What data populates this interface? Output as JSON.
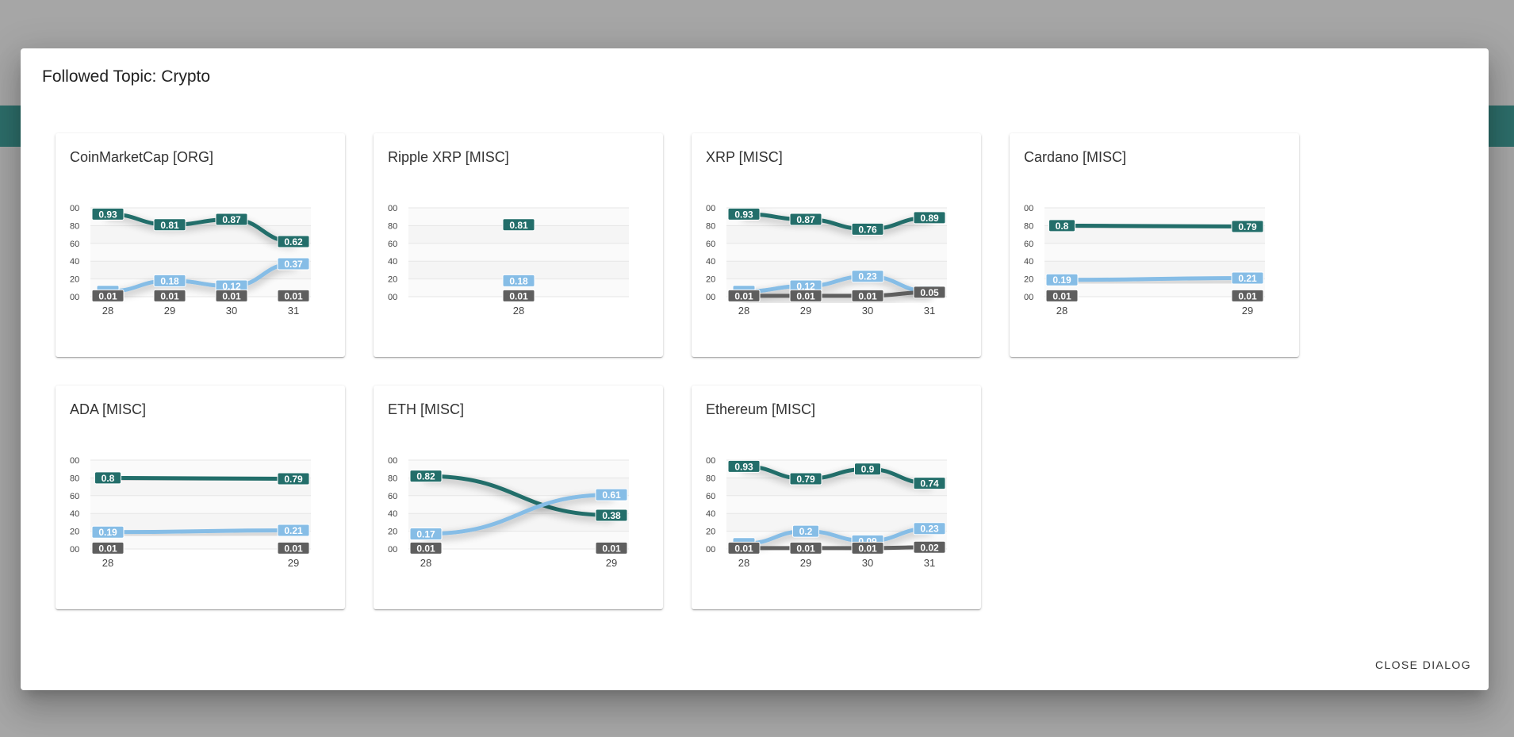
{
  "dialog": {
    "title": "Followed Topic: Crypto",
    "close_label": "CLOSE DIALOG"
  },
  "colors": {
    "positive": "#236e6a",
    "neutral": "#86bde6",
    "negative": "#5e5e5e"
  },
  "y_tick_labels": [
    "00",
    "80",
    "60",
    "40",
    "20",
    "00"
  ],
  "cards": [
    {
      "title": "CoinMarketCap [ORG]",
      "chart_data": {
        "type": "line",
        "x": [
          "28",
          "29",
          "30",
          "31"
        ],
        "ylim": [
          0,
          1
        ],
        "series": [
          {
            "values": [
              0.93,
              0.81,
              0.87,
              0.62
            ],
            "labels": [
              "0.93",
              "0.81",
              "0.87",
              "0.62"
            ]
          },
          {
            "values": [
              0.06,
              0.18,
              0.12,
              0.37
            ],
            "labels": [
              "",
              "0.18",
              "0.12",
              "0.37"
            ]
          },
          {
            "values": [
              0.01,
              0.01,
              0.01,
              0.01
            ],
            "labels": [
              "0.01",
              "0.01",
              "0.01",
              "0.01"
            ]
          }
        ]
      }
    },
    {
      "title": "Ripple XRP [MISC]",
      "chart_data": {
        "type": "line",
        "x": [
          "28"
        ],
        "ylim": [
          0,
          1
        ],
        "series": [
          {
            "values": [
              0.81
            ],
            "labels": [
              "0.81"
            ]
          },
          {
            "values": [
              0.18
            ],
            "labels": [
              "0.18"
            ]
          },
          {
            "values": [
              0.01
            ],
            "labels": [
              "0.01"
            ]
          }
        ]
      }
    },
    {
      "title": "XRP [MISC]",
      "chart_data": {
        "type": "line",
        "x": [
          "28",
          "29",
          "30",
          "31"
        ],
        "ylim": [
          0,
          1
        ],
        "series": [
          {
            "values": [
              0.93,
              0.87,
              0.76,
              0.89
            ],
            "labels": [
              "0.93",
              "0.87",
              "0.76",
              "0.89"
            ]
          },
          {
            "values": [
              0.06,
              0.12,
              0.23,
              0.06
            ],
            "labels": [
              "",
              "0.12",
              "0.23",
              ""
            ]
          },
          {
            "values": [
              0.01,
              0.01,
              0.01,
              0.05
            ],
            "labels": [
              "0.01",
              "0.01",
              "0.01",
              "0.05"
            ]
          }
        ]
      }
    },
    {
      "title": "Cardano [MISC]",
      "chart_data": {
        "type": "line",
        "x": [
          "28",
          "29"
        ],
        "ylim": [
          0,
          1
        ],
        "series": [
          {
            "values": [
              0.8,
              0.79
            ],
            "labels": [
              "0.8",
              "0.79"
            ]
          },
          {
            "values": [
              0.19,
              0.21
            ],
            "labels": [
              "0.19",
              "0.21"
            ]
          },
          {
            "values": [
              0.01,
              0.01
            ],
            "labels": [
              "0.01",
              "0.01"
            ]
          }
        ]
      }
    },
    {
      "title": "ADA [MISC]",
      "chart_data": {
        "type": "line",
        "x": [
          "28",
          "29"
        ],
        "ylim": [
          0,
          1
        ],
        "series": [
          {
            "values": [
              0.8,
              0.79
            ],
            "labels": [
              "0.8",
              "0.79"
            ]
          },
          {
            "values": [
              0.19,
              0.21
            ],
            "labels": [
              "0.19",
              "0.21"
            ]
          },
          {
            "values": [
              0.01,
              0.01
            ],
            "labels": [
              "0.01",
              "0.01"
            ]
          }
        ]
      }
    },
    {
      "title": "ETH [MISC]",
      "chart_data": {
        "type": "line",
        "x": [
          "28",
          "29"
        ],
        "ylim": [
          0,
          1
        ],
        "series": [
          {
            "values": [
              0.82,
              0.38
            ],
            "labels": [
              "0.82",
              "0.38"
            ]
          },
          {
            "values": [
              0.17,
              0.61
            ],
            "labels": [
              "0.17",
              "0.61"
            ]
          },
          {
            "values": [
              0.01,
              0.01
            ],
            "labels": [
              "0.01",
              "0.01"
            ]
          }
        ]
      }
    },
    {
      "title": "Ethereum [MISC]",
      "chart_data": {
        "type": "line",
        "x": [
          "28",
          "29",
          "30",
          "31"
        ],
        "ylim": [
          0,
          1
        ],
        "series": [
          {
            "values": [
              0.93,
              0.79,
              0.9,
              0.74
            ],
            "labels": [
              "0.93",
              "0.79",
              "0.9",
              "0.74"
            ]
          },
          {
            "values": [
              0.06,
              0.2,
              0.09,
              0.23
            ],
            "labels": [
              "",
              "0.2",
              "0.09",
              "0.23"
            ]
          },
          {
            "values": [
              0.01,
              0.01,
              0.01,
              0.02
            ],
            "labels": [
              "0.01",
              "0.01",
              "0.01",
              "0.02"
            ]
          }
        ]
      }
    }
  ]
}
